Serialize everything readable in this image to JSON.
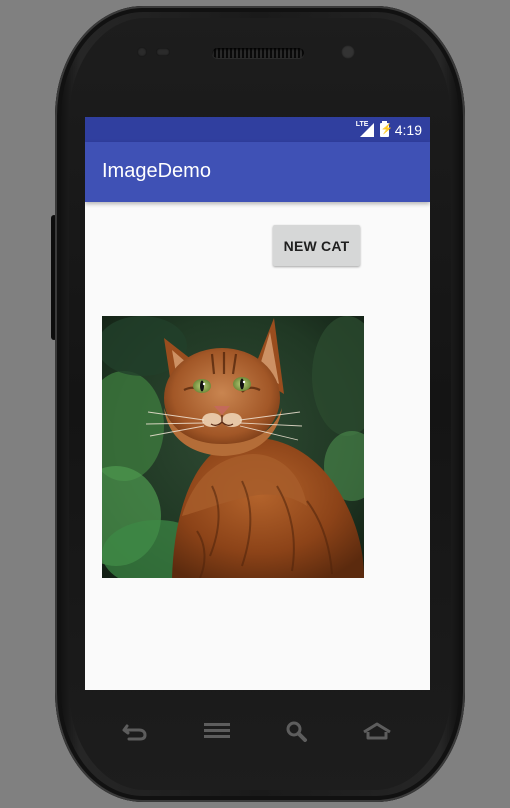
{
  "status_bar": {
    "network": "LTE",
    "time": "4:19"
  },
  "app_bar": {
    "title": "ImageDemo"
  },
  "content": {
    "new_cat_button_label": "NEW CAT",
    "image_subject": "orange-tabby-cat"
  },
  "nav_bar": {
    "icons": [
      "back-icon",
      "menu-icon",
      "search-icon",
      "home-icon"
    ]
  },
  "colors": {
    "status_bar": "#303f9f",
    "app_bar": "#3f51b5",
    "screen_background": "#fafafa",
    "button_background": "#d6d7d7",
    "emulator_background": "#808080"
  }
}
